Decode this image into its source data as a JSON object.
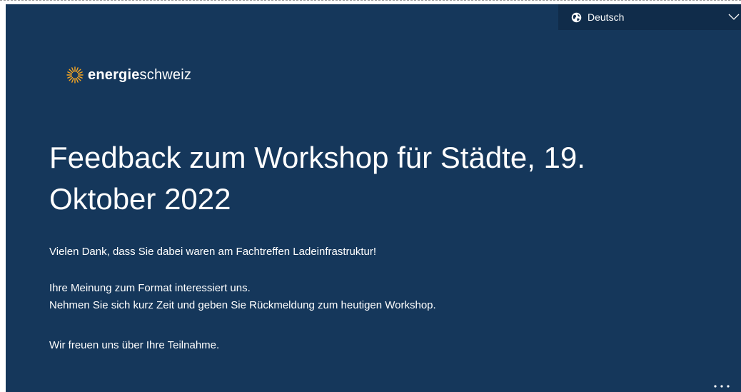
{
  "language_selector": {
    "icon": "globe-icon",
    "selected": "Deutsch",
    "chevron": "chevron-down-icon"
  },
  "logo": {
    "icon": "sun-rays-icon",
    "bold_part": "energie",
    "regular_part": "schweiz",
    "accent_color": "#f5a623"
  },
  "form": {
    "title": "Feedback zum Workshop für Städte, 19. Oktober 2022",
    "intro": "Vielen Dank, dass Sie dabei waren am Fachtreffen Ladeinfrastruktur!",
    "paragraph_line1": "Ihre Meinung zum Format interessiert uns.",
    "paragraph_line2": "Nehmen Sie sich kurz Zeit und geben Sie Rückmeldung zum heutigen Workshop.",
    "closing": "Wir freuen uns über Ihre Teilnahme."
  },
  "more_menu": {
    "icon": "more-dots-icon"
  },
  "colors": {
    "background": "#15375b",
    "language_bar": "#102c4a",
    "text": "#ffffff"
  }
}
